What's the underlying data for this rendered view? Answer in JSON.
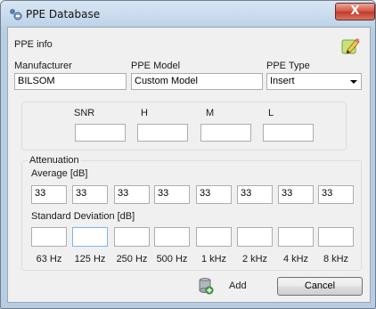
{
  "window": {
    "title": "PPE Database",
    "close_glyph": "X"
  },
  "ppe_info": {
    "section_label": "PPE info",
    "manufacturer_label": "Manufacturer",
    "manufacturer_value": "BILSOM",
    "model_label": "PPE Model",
    "model_value": "Custom Model",
    "type_label": "PPE Type",
    "type_value": "Insert",
    "edit_icon": "pencil-icon"
  },
  "snr_hml": {
    "labels": [
      "SNR",
      "H",
      "M",
      "L"
    ],
    "values": [
      "",
      "",
      "",
      ""
    ]
  },
  "attenuation": {
    "group_label": "Attenuation",
    "average_label": "Average [dB]",
    "average_values": [
      "33",
      "33",
      "33",
      "33",
      "33",
      "33",
      "33",
      "33"
    ],
    "stddev_label": "Standard Deviation [dB]",
    "stddev_values": [
      "",
      "",
      "",
      "",
      "",
      "",
      "",
      ""
    ],
    "frequencies": [
      "63 Hz",
      "125 Hz",
      "250 Hz",
      "500 Hz",
      "1 kHz",
      "2 kHz",
      "4 kHz",
      "8 kHz"
    ]
  },
  "footer": {
    "add_icon": "database-add-icon",
    "add_label": "Add",
    "cancel_label": "Cancel"
  }
}
